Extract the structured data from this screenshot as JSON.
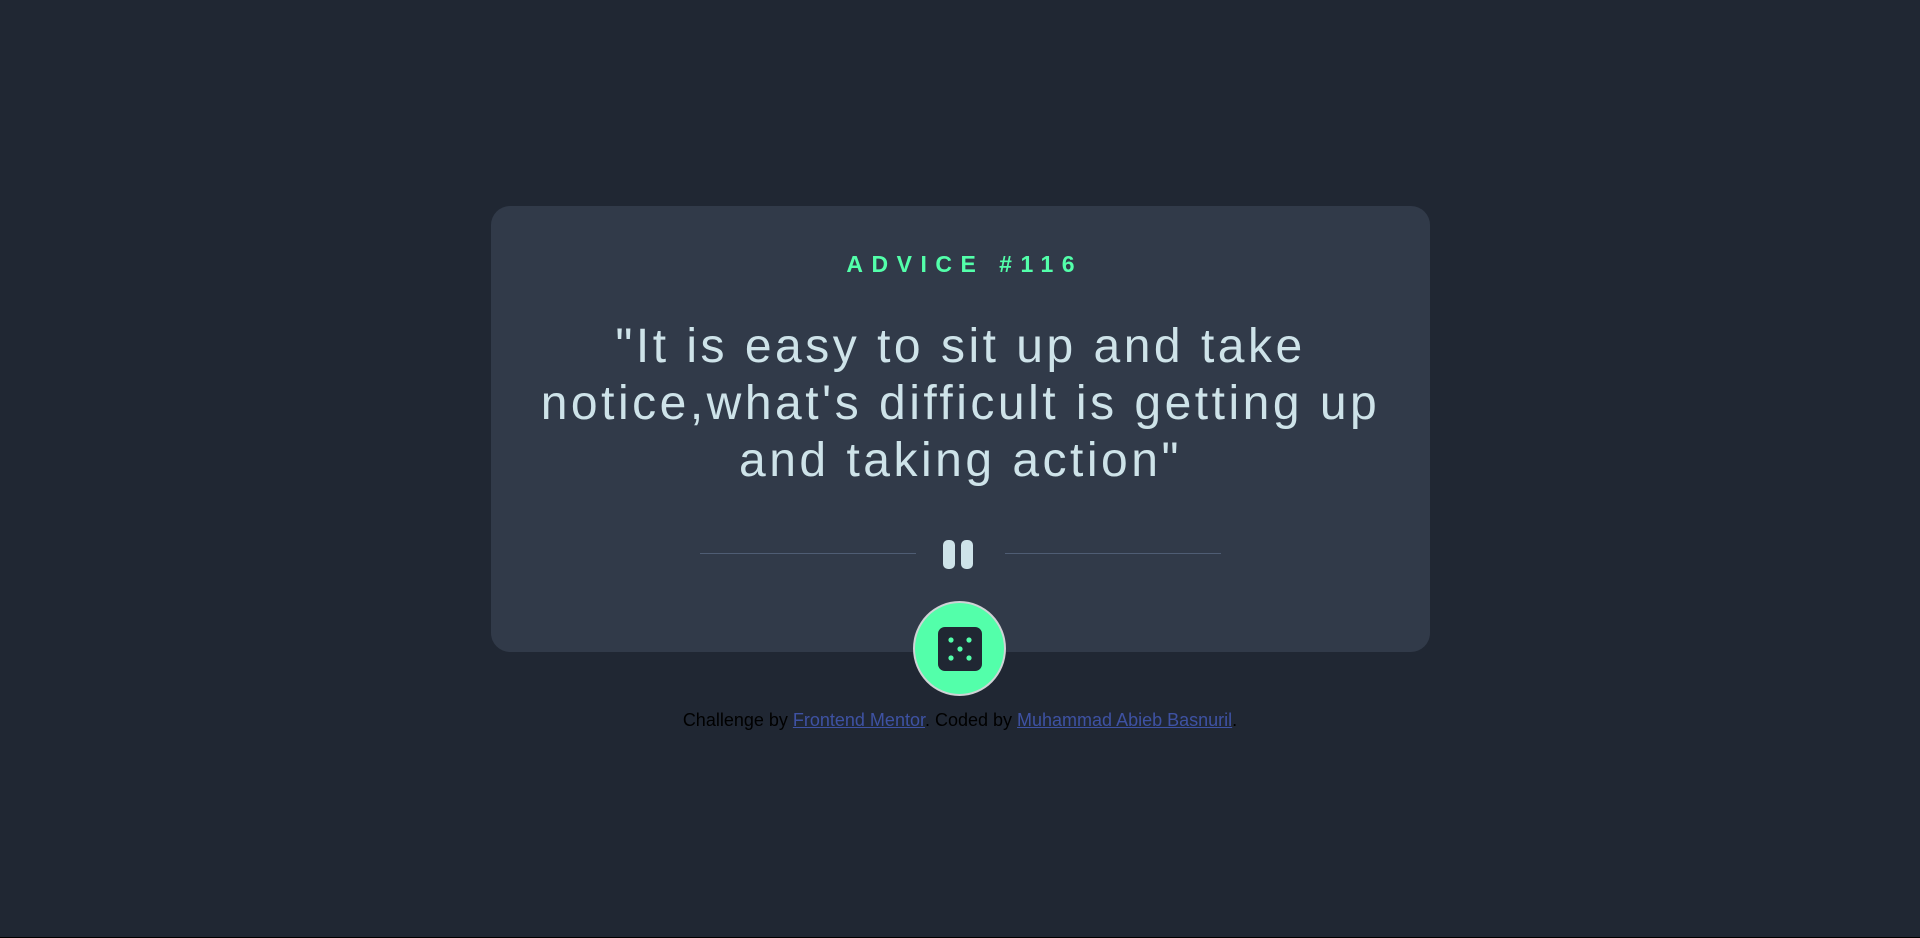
{
  "advice": {
    "heading": "ADVICE #116",
    "quote": "\"It is easy to sit up and take notice,what's difficult is getting up and taking action\""
  },
  "dice_button": {
    "icon": "dice-icon"
  },
  "divider": {
    "icon": "pause-icon"
  },
  "footer": {
    "challenge_prefix": "Challenge by ",
    "challenge_link": "Frontend Mentor",
    "separator": ". Coded by ",
    "author_link": "Muhammad Abieb Basnuril",
    "suffix": "."
  },
  "colors": {
    "background": "#202733",
    "card": "#313a49",
    "accent": "#53ffaa",
    "text": "#cee3e9",
    "link": "#3e52a3"
  }
}
